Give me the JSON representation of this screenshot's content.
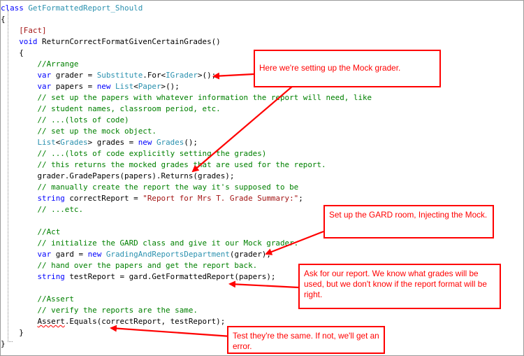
{
  "code_lines": [
    [
      [
        "kw",
        "class "
      ],
      [
        "ty",
        "GetFormattedReport_Should"
      ]
    ],
    [
      [
        "",
        "{"
      ]
    ],
    [
      [
        "",
        "    "
      ],
      [
        "at",
        "[Fact]"
      ]
    ],
    [
      [
        "",
        "    "
      ],
      [
        "kw",
        "void "
      ],
      [
        "",
        "ReturnCorrectFormatGivenCertainGrades()"
      ]
    ],
    [
      [
        "",
        "    {"
      ]
    ],
    [
      [
        "",
        "        "
      ],
      [
        "cm",
        "//Arrange"
      ]
    ],
    [
      [
        "",
        "        "
      ],
      [
        "kw",
        "var "
      ],
      [
        "",
        "grader = "
      ],
      [
        "ty",
        "Substitute"
      ],
      [
        "",
        ".For<"
      ],
      [
        "ty",
        "IGrader"
      ],
      [
        "",
        ">();"
      ]
    ],
    [
      [
        "",
        "        "
      ],
      [
        "kw",
        "var "
      ],
      [
        "",
        "papers = "
      ],
      [
        "kw",
        "new "
      ],
      [
        "ty",
        "List"
      ],
      [
        "",
        "<"
      ],
      [
        "ty",
        "Paper"
      ],
      [
        "",
        ">();"
      ]
    ],
    [
      [
        "",
        "        "
      ],
      [
        "cm",
        "// set up the papers with whatever information the report will need, like"
      ]
    ],
    [
      [
        "",
        "        "
      ],
      [
        "cm",
        "// student names, classroom period, etc."
      ]
    ],
    [
      [
        "",
        "        "
      ],
      [
        "cm",
        "// ...(lots of code)"
      ]
    ],
    [
      [
        "",
        "        "
      ],
      [
        "cm",
        "// set up the mock object."
      ]
    ],
    [
      [
        "",
        "        "
      ],
      [
        "ty",
        "List"
      ],
      [
        "",
        "<"
      ],
      [
        "ty",
        "Grades"
      ],
      [
        "",
        "> grades = "
      ],
      [
        "kw",
        "new "
      ],
      [
        "ty",
        "Grades"
      ],
      [
        "",
        "();"
      ]
    ],
    [
      [
        "",
        "        "
      ],
      [
        "cm",
        "// ...(lots of code explicitly setting the grades)"
      ]
    ],
    [
      [
        "",
        "        "
      ],
      [
        "cm",
        "// this returns the mocked grades that are used for the report."
      ]
    ],
    [
      [
        "",
        "        grader.GradePapers(papers).Returns(grades);"
      ]
    ],
    [
      [
        "",
        "        "
      ],
      [
        "cm",
        "// manually create the report the way it's supposed to be"
      ]
    ],
    [
      [
        "",
        "        "
      ],
      [
        "kw",
        "string "
      ],
      [
        "",
        "correctReport = "
      ],
      [
        "st",
        "\"Report for Mrs T. Grade Summary:\""
      ],
      [
        "",
        ";"
      ]
    ],
    [
      [
        "",
        "        "
      ],
      [
        "cm",
        "// ...etc."
      ]
    ],
    [
      [
        "",
        ""
      ]
    ],
    [
      [
        "",
        "        "
      ],
      [
        "cm",
        "//Act"
      ]
    ],
    [
      [
        "",
        "        "
      ],
      [
        "cm",
        "// initialize the GARD class and give it our Mock grader."
      ]
    ],
    [
      [
        "",
        "        "
      ],
      [
        "kw",
        "var "
      ],
      [
        "",
        "gard = "
      ],
      [
        "kw",
        "new "
      ],
      [
        "ty",
        "GradingAndReportsDepartment"
      ],
      [
        "",
        "(grader);"
      ]
    ],
    [
      [
        "",
        "        "
      ],
      [
        "cm",
        "// hand over the papers and get the report back."
      ]
    ],
    [
      [
        "",
        "        "
      ],
      [
        "kw",
        "string "
      ],
      [
        "",
        "testReport = gard.GetFormattedReport(papers);"
      ]
    ],
    [
      [
        "",
        ""
      ]
    ],
    [
      [
        "",
        "        "
      ],
      [
        "cm",
        "//Assert"
      ]
    ],
    [
      [
        "",
        "        "
      ],
      [
        "cm",
        "// verify the reports are the same."
      ]
    ],
    [
      [
        "",
        "        "
      ],
      [
        "sq",
        "Assert"
      ],
      [
        "",
        ".Equals(correctReport, testReport);"
      ]
    ],
    [
      [
        "",
        "    }"
      ]
    ],
    [
      [
        "",
        "}"
      ]
    ]
  ],
  "callouts": {
    "mock": "Here we're setting up the Mock grader.",
    "gard": "Set up the GARD room, Injecting the Mock.",
    "ask": "Ask for our report. We know what grades will be used, but we don't know if the report format will be right.",
    "test": "Test they're the same. If not, we'll get an error."
  },
  "colors": {
    "keyword": "#0000ff",
    "type": "#2b91af",
    "comment": "#008000",
    "string": "#a31515",
    "annotation": "#ff0000"
  }
}
